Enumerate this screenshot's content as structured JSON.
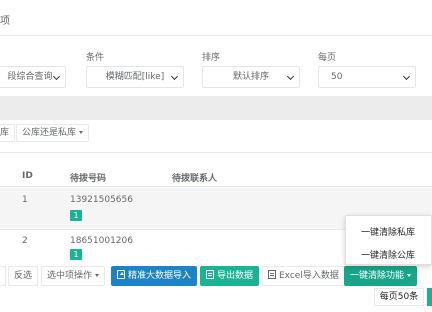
{
  "panel": {
    "title_fragment": "项"
  },
  "filters": {
    "field": {
      "value": "段综合查询"
    },
    "condition": {
      "label": "条件",
      "value": "模糊匹配[like]"
    },
    "sort": {
      "label": "排序",
      "value": "默认排序"
    },
    "per_page": {
      "label": "每页",
      "value": "50"
    }
  },
  "toolbar_top": {
    "left_fragment": "库",
    "library_dropdown": "公库还是私库"
  },
  "table": {
    "headers": {
      "id": "ID",
      "number": "待拨号码",
      "contact": "待拨联系人"
    },
    "rows": [
      {
        "id": "1",
        "number": "13921505656",
        "badge": "1"
      },
      {
        "id": "2",
        "number": "18651001206",
        "badge": "1"
      }
    ]
  },
  "toolbar_bottom": {
    "invert": "反选",
    "selected_ops": "选中项操作",
    "bulk_import": "精准大数据导入",
    "export": "导出数据",
    "excel_import": "Excel导入数据",
    "clear_func": "一键清除功能"
  },
  "clear_menu": {
    "items": [
      "一键清除私库",
      "一键清除公库"
    ]
  },
  "pagination": {
    "page_size": "每页50条"
  },
  "colors": {
    "primary": "#1ab394",
    "blue": "#1c84c6",
    "highlight_row": "#f5f5f5"
  }
}
